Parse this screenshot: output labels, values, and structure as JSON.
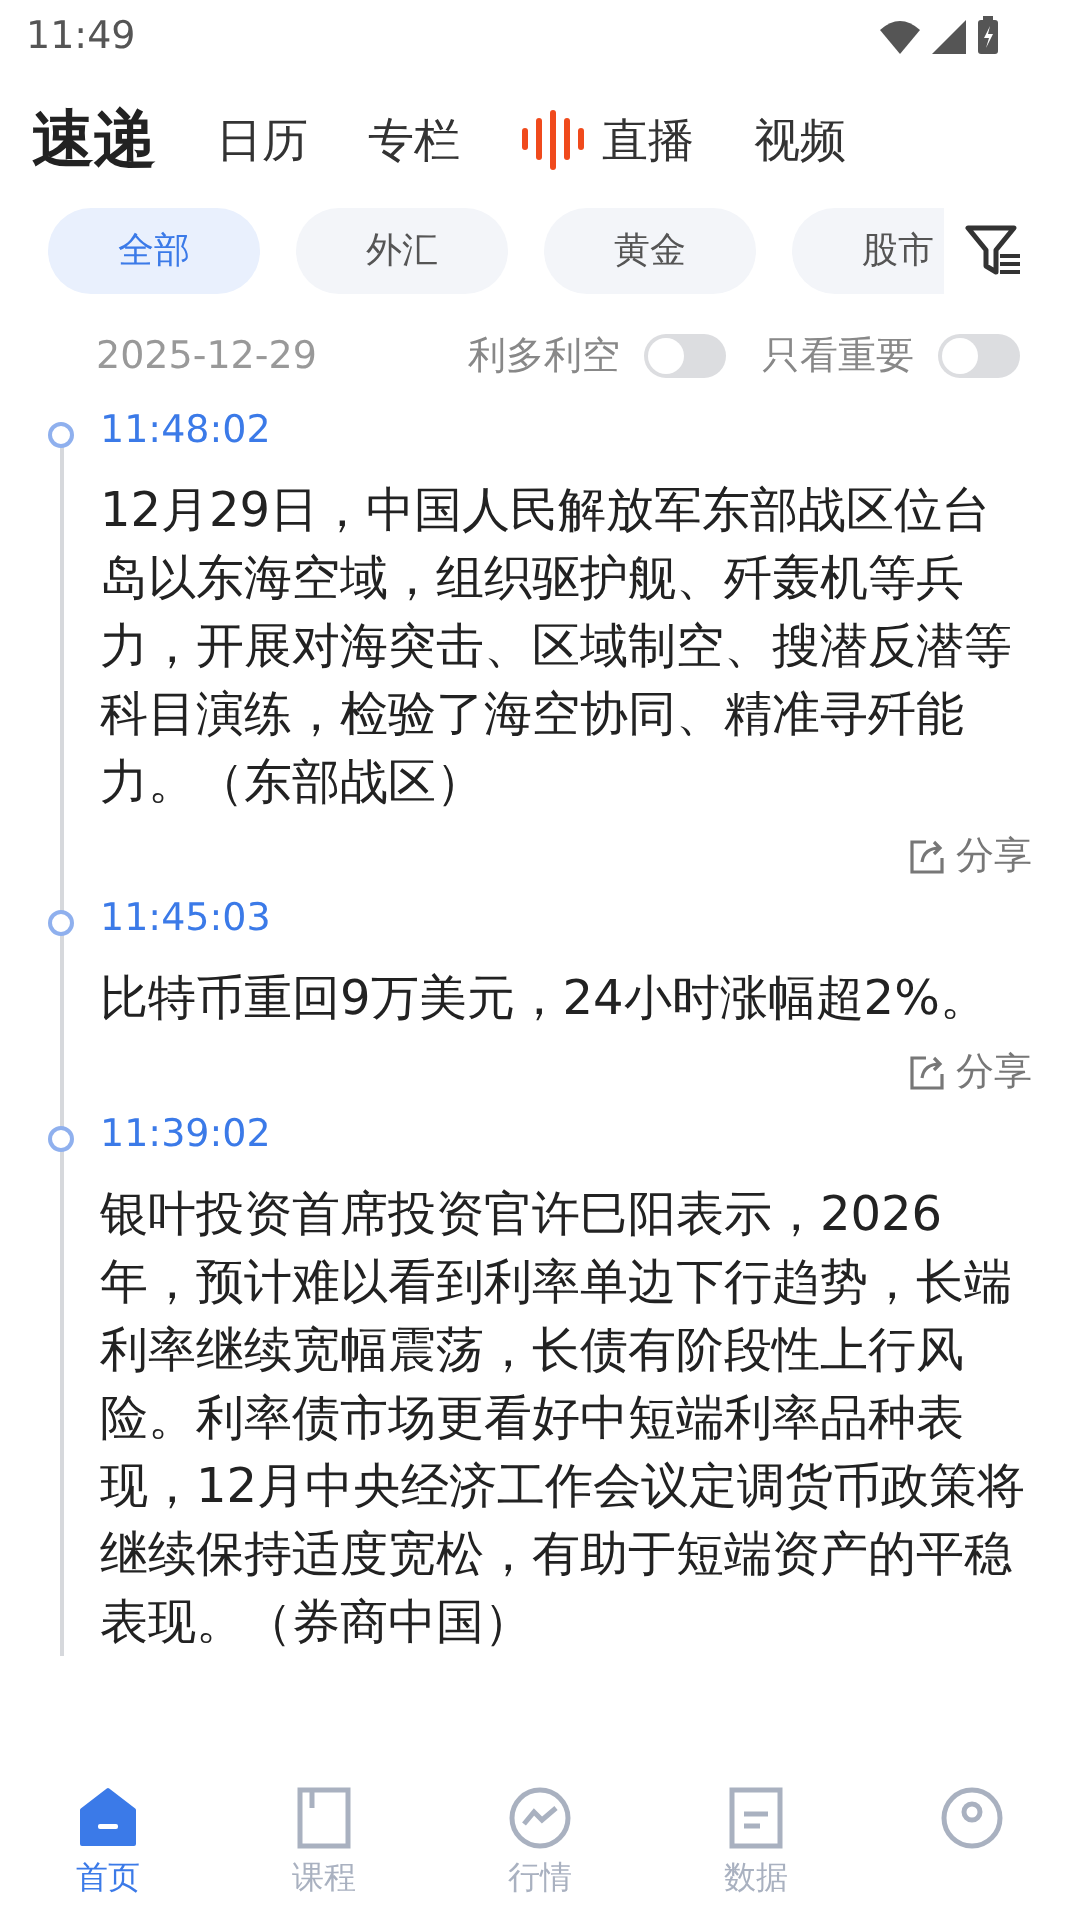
{
  "status_bar": {
    "time": "11:49"
  },
  "top_tabs": [
    {
      "label": "速递",
      "selected": true,
      "kind": "text"
    },
    {
      "label": "日历",
      "selected": false,
      "kind": "text"
    },
    {
      "label": "专栏",
      "selected": false,
      "kind": "text"
    },
    {
      "label": "直播",
      "selected": false,
      "kind": "live"
    },
    {
      "label": "视频",
      "selected": false,
      "kind": "text"
    }
  ],
  "categories": [
    {
      "label": "全部",
      "selected": true
    },
    {
      "label": "外汇",
      "selected": false
    },
    {
      "label": "黄金",
      "selected": false
    },
    {
      "label": "股市",
      "selected": false
    }
  ],
  "filter_bar": {
    "date": "2025-12-29",
    "toggles": [
      {
        "label": "利多利空",
        "on": false
      },
      {
        "label": "只看重要",
        "on": false
      }
    ]
  },
  "news": [
    {
      "time": "11:48:02",
      "text": "12月29日，中国人民解放军东部战区位台岛以东海空域，组织驱护舰、歼轰机等兵力，开展对海突击、区域制空、搜潜反潜等科目演练，检验了海空协同、精准寻歼能力。（东部战区）",
      "share": "分享"
    },
    {
      "time": "11:45:03",
      "text": "比特币重回9万美元，24小时涨幅超2%。",
      "share": "分享"
    },
    {
      "time": "11:39:02",
      "text": "银叶投资首席投资官许巳阳表示，2026年，预计难以看到利率单边下行趋势，长端利率继续宽幅震荡，长债有阶段性上行风险。利率债市场更看好中短端利率品种表现，12月中央经济工作会议定调货币政策将继续保持适度宽松，有助于短端资产的平稳表现。（券商中国）"
    }
  ],
  "bottom_nav": [
    {
      "label": "首页",
      "selected": true,
      "kind": "home"
    },
    {
      "label": "课程",
      "selected": false,
      "kind": "book"
    },
    {
      "label": "行情",
      "selected": false,
      "kind": "chart"
    },
    {
      "label": "数据",
      "selected": false,
      "kind": "data"
    },
    {
      "selected": false,
      "kind": "profile"
    }
  ]
}
